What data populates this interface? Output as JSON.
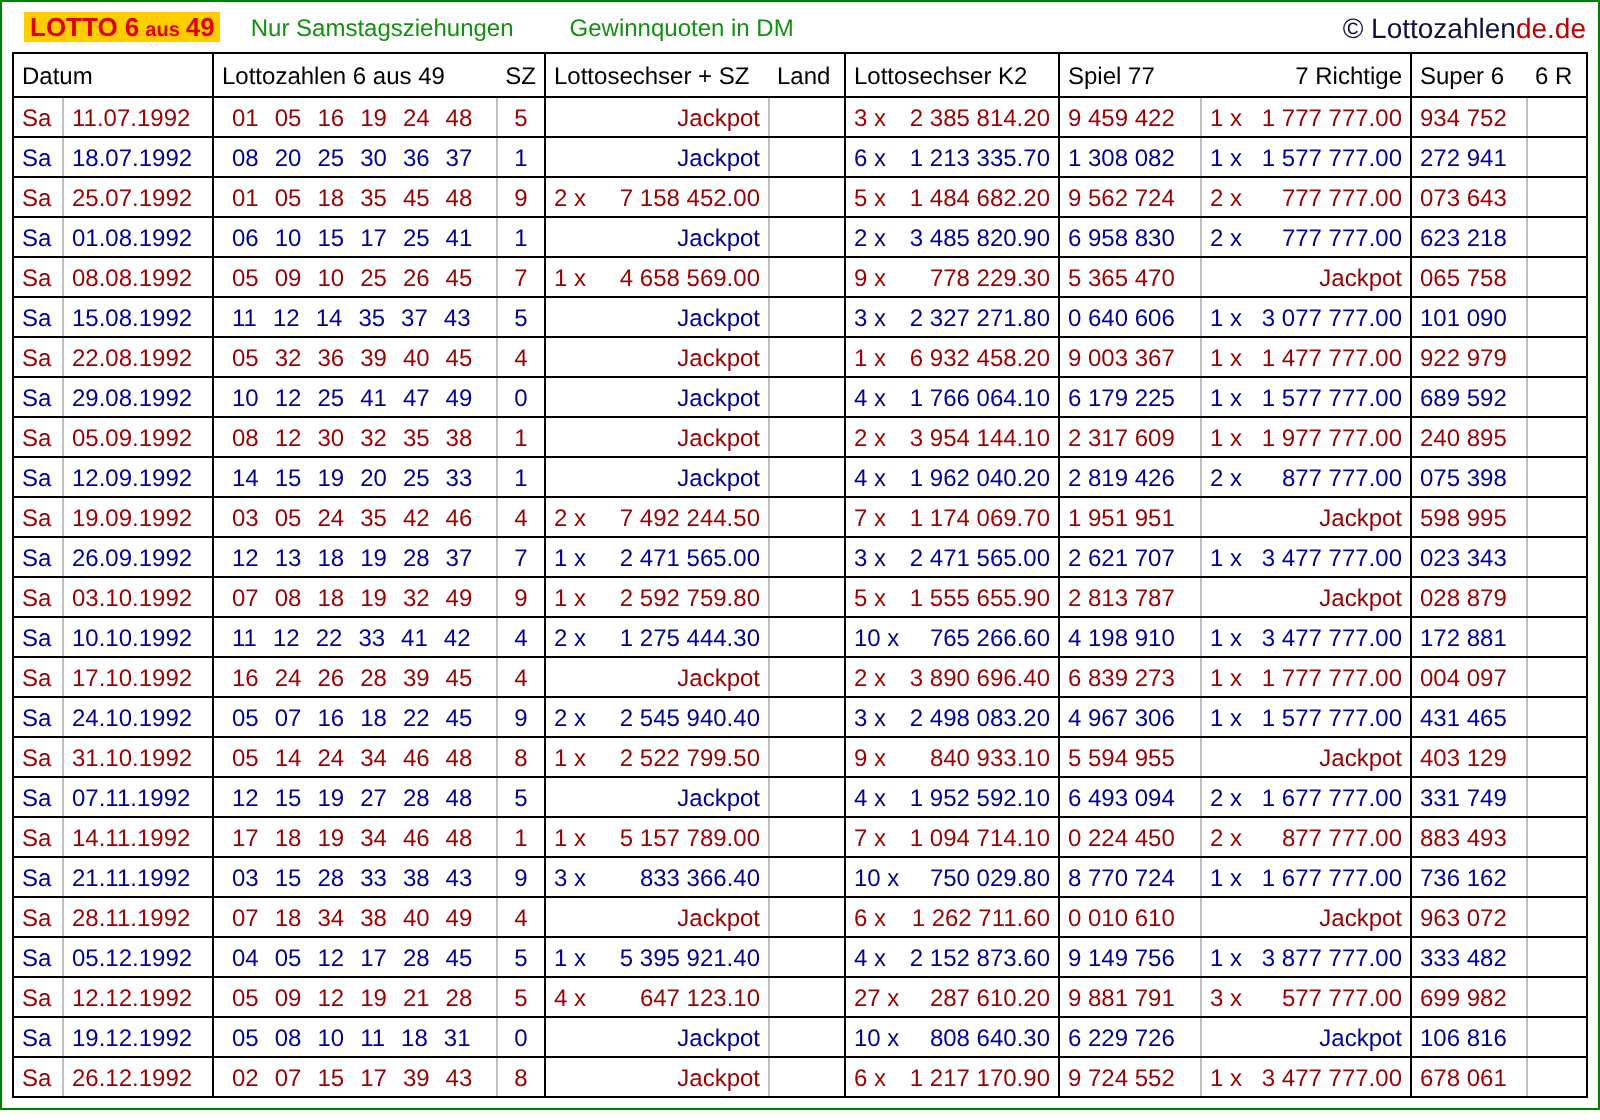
{
  "header": {
    "logo": [
      "LOTTO 6",
      "aus",
      "49"
    ],
    "links": [
      "Nur Samstagsziehungen",
      "Gewinnquoten in DM"
    ],
    "brand": [
      "© Lottozahlen",
      "de.de"
    ]
  },
  "table": {
    "columns": [
      "Datum",
      "Lottozahlen 6 aus 49",
      "SZ",
      "Lottosechser + SZ",
      "Land",
      "Lottosechser K2",
      "Spiel 77",
      "7 Richtige",
      "Super 6",
      "6 R"
    ],
    "rows": [
      {
        "day": "Sa",
        "date": "11.07.1992",
        "numbers": [
          "01",
          "05",
          "16",
          "19",
          "24",
          "48"
        ],
        "sz": "5",
        "sechser": {
          "amount": "Jackpot"
        },
        "k2": {
          "count": "3 x",
          "amount": "2 385 814.20"
        },
        "spiel77": "9 459 422",
        "richtige7": {
          "count": "1 x",
          "amount": "1 777 777.00"
        },
        "super6": "934 752"
      },
      {
        "day": "Sa",
        "date": "18.07.1992",
        "numbers": [
          "08",
          "20",
          "25",
          "30",
          "36",
          "37"
        ],
        "sz": "1",
        "sechser": {
          "amount": "Jackpot"
        },
        "k2": {
          "count": "6 x",
          "amount": "1 213 335.70"
        },
        "spiel77": "1 308 082",
        "richtige7": {
          "count": "1 x",
          "amount": "1 577 777.00"
        },
        "super6": "272 941"
      },
      {
        "day": "Sa",
        "date": "25.07.1992",
        "numbers": [
          "01",
          "05",
          "18",
          "35",
          "45",
          "48"
        ],
        "sz": "9",
        "sechser": {
          "count": "2 x",
          "amount": "7 158 452.00"
        },
        "k2": {
          "count": "5 x",
          "amount": "1 484 682.20"
        },
        "spiel77": "9 562 724",
        "richtige7": {
          "count": "2 x",
          "amount": "777 777.00"
        },
        "super6": "073 643"
      },
      {
        "day": "Sa",
        "date": "01.08.1992",
        "numbers": [
          "06",
          "10",
          "15",
          "17",
          "25",
          "41"
        ],
        "sz": "1",
        "sechser": {
          "amount": "Jackpot"
        },
        "k2": {
          "count": "2 x",
          "amount": "3 485 820.90"
        },
        "spiel77": "6 958 830",
        "richtige7": {
          "count": "2 x",
          "amount": "777 777.00"
        },
        "super6": "623 218"
      },
      {
        "day": "Sa",
        "date": "08.08.1992",
        "numbers": [
          "05",
          "09",
          "10",
          "25",
          "26",
          "45"
        ],
        "sz": "7",
        "sechser": {
          "count": "1 x",
          "amount": "4 658 569.00"
        },
        "k2": {
          "count": "9 x",
          "amount": "778 229.30"
        },
        "spiel77": "5 365 470",
        "richtige7": {
          "amount": "Jackpot"
        },
        "super6": "065 758"
      },
      {
        "day": "Sa",
        "date": "15.08.1992",
        "numbers": [
          "11",
          "12",
          "14",
          "35",
          "37",
          "43"
        ],
        "sz": "5",
        "sechser": {
          "amount": "Jackpot"
        },
        "k2": {
          "count": "3 x",
          "amount": "2 327 271.80"
        },
        "spiel77": "0 640 606",
        "richtige7": {
          "count": "1 x",
          "amount": "3 077 777.00"
        },
        "super6": "101 090"
      },
      {
        "day": "Sa",
        "date": "22.08.1992",
        "numbers": [
          "05",
          "32",
          "36",
          "39",
          "40",
          "45"
        ],
        "sz": "4",
        "sechser": {
          "amount": "Jackpot"
        },
        "k2": {
          "count": "1 x",
          "amount": "6 932 458.20"
        },
        "spiel77": "9 003 367",
        "richtige7": {
          "count": "1 x",
          "amount": "1 477 777.00"
        },
        "super6": "922 979"
      },
      {
        "day": "Sa",
        "date": "29.08.1992",
        "numbers": [
          "10",
          "12",
          "25",
          "41",
          "47",
          "49"
        ],
        "sz": "0",
        "sechser": {
          "amount": "Jackpot"
        },
        "k2": {
          "count": "4 x",
          "amount": "1 766 064.10"
        },
        "spiel77": "6 179 225",
        "richtige7": {
          "count": "1 x",
          "amount": "1 577 777.00"
        },
        "super6": "689 592"
      },
      {
        "day": "Sa",
        "date": "05.09.1992",
        "numbers": [
          "08",
          "12",
          "30",
          "32",
          "35",
          "38"
        ],
        "sz": "1",
        "sechser": {
          "amount": "Jackpot"
        },
        "k2": {
          "count": "2 x",
          "amount": "3 954 144.10"
        },
        "spiel77": "2 317 609",
        "richtige7": {
          "count": "1 x",
          "amount": "1 977 777.00"
        },
        "super6": "240 895"
      },
      {
        "day": "Sa",
        "date": "12.09.1992",
        "numbers": [
          "14",
          "15",
          "19",
          "20",
          "25",
          "33"
        ],
        "sz": "1",
        "sechser": {
          "amount": "Jackpot"
        },
        "k2": {
          "count": "4 x",
          "amount": "1 962 040.20"
        },
        "spiel77": "2 819 426",
        "richtige7": {
          "count": "2 x",
          "amount": "877 777.00"
        },
        "super6": "075 398"
      },
      {
        "day": "Sa",
        "date": "19.09.1992",
        "numbers": [
          "03",
          "05",
          "24",
          "35",
          "42",
          "46"
        ],
        "sz": "4",
        "sechser": {
          "count": "2 x",
          "amount": "7 492 244.50"
        },
        "k2": {
          "count": "7 x",
          "amount": "1 174 069.70"
        },
        "spiel77": "1 951 951",
        "richtige7": {
          "amount": "Jackpot"
        },
        "super6": "598 995"
      },
      {
        "day": "Sa",
        "date": "26.09.1992",
        "numbers": [
          "12",
          "13",
          "18",
          "19",
          "28",
          "37"
        ],
        "sz": "7",
        "sechser": {
          "count": "1 x",
          "amount": "2 471 565.00"
        },
        "k2": {
          "count": "3 x",
          "amount": "2 471 565.00"
        },
        "spiel77": "2 621 707",
        "richtige7": {
          "count": "1 x",
          "amount": "3 477 777.00"
        },
        "super6": "023 343"
      },
      {
        "day": "Sa",
        "date": "03.10.1992",
        "numbers": [
          "07",
          "08",
          "18",
          "19",
          "32",
          "49"
        ],
        "sz": "9",
        "sechser": {
          "count": "1 x",
          "amount": "2 592 759.80"
        },
        "k2": {
          "count": "5 x",
          "amount": "1 555 655.90"
        },
        "spiel77": "2 813 787",
        "richtige7": {
          "amount": "Jackpot"
        },
        "super6": "028 879"
      },
      {
        "day": "Sa",
        "date": "10.10.1992",
        "numbers": [
          "11",
          "12",
          "22",
          "33",
          "41",
          "42"
        ],
        "sz": "4",
        "sechser": {
          "count": "2 x",
          "amount": "1 275 444.30"
        },
        "k2": {
          "count": "10 x",
          "amount": "765 266.60"
        },
        "spiel77": "4 198 910",
        "richtige7": {
          "count": "1 x",
          "amount": "3 477 777.00"
        },
        "super6": "172 881"
      },
      {
        "day": "Sa",
        "date": "17.10.1992",
        "numbers": [
          "16",
          "24",
          "26",
          "28",
          "39",
          "45"
        ],
        "sz": "4",
        "sechser": {
          "amount": "Jackpot"
        },
        "k2": {
          "count": "2 x",
          "amount": "3 890 696.40"
        },
        "spiel77": "6 839 273",
        "richtige7": {
          "count": "1 x",
          "amount": "1 777 777.00"
        },
        "super6": "004 097"
      },
      {
        "day": "Sa",
        "date": "24.10.1992",
        "numbers": [
          "05",
          "07",
          "16",
          "18",
          "22",
          "45"
        ],
        "sz": "9",
        "sechser": {
          "count": "2 x",
          "amount": "2 545 940.40"
        },
        "k2": {
          "count": "3 x",
          "amount": "2 498 083.20"
        },
        "spiel77": "4 967 306",
        "richtige7": {
          "count": "1 x",
          "amount": "1 577 777.00"
        },
        "super6": "431 465"
      },
      {
        "day": "Sa",
        "date": "31.10.1992",
        "numbers": [
          "05",
          "14",
          "24",
          "34",
          "46",
          "48"
        ],
        "sz": "8",
        "sechser": {
          "count": "1 x",
          "amount": "2 522 799.50"
        },
        "k2": {
          "count": "9 x",
          "amount": "840 933.10"
        },
        "spiel77": "5 594 955",
        "richtige7": {
          "amount": "Jackpot"
        },
        "super6": "403 129"
      },
      {
        "day": "Sa",
        "date": "07.11.1992",
        "numbers": [
          "12",
          "15",
          "19",
          "27",
          "28",
          "48"
        ],
        "sz": "5",
        "sechser": {
          "amount": "Jackpot"
        },
        "k2": {
          "count": "4 x",
          "amount": "1 952 592.10"
        },
        "spiel77": "6 493 094",
        "richtige7": {
          "count": "2 x",
          "amount": "1 677 777.00"
        },
        "super6": "331 749"
      },
      {
        "day": "Sa",
        "date": "14.11.1992",
        "numbers": [
          "17",
          "18",
          "19",
          "34",
          "46",
          "48"
        ],
        "sz": "1",
        "sechser": {
          "count": "1 x",
          "amount": "5 157 789.00"
        },
        "k2": {
          "count": "7 x",
          "amount": "1 094 714.10"
        },
        "spiel77": "0 224 450",
        "richtige7": {
          "count": "2 x",
          "amount": "877 777.00"
        },
        "super6": "883 493"
      },
      {
        "day": "Sa",
        "date": "21.11.1992",
        "numbers": [
          "03",
          "15",
          "28",
          "33",
          "38",
          "43"
        ],
        "sz": "9",
        "sechser": {
          "count": "3 x",
          "amount": "833 366.40"
        },
        "k2": {
          "count": "10 x",
          "amount": "750 029.80"
        },
        "spiel77": "8 770 724",
        "richtige7": {
          "count": "1 x",
          "amount": "1 677 777.00"
        },
        "super6": "736 162"
      },
      {
        "day": "Sa",
        "date": "28.11.1992",
        "numbers": [
          "07",
          "18",
          "34",
          "38",
          "40",
          "49"
        ],
        "sz": "4",
        "sechser": {
          "amount": "Jackpot"
        },
        "k2": {
          "count": "6 x",
          "amount": "1 262 711.60"
        },
        "spiel77": "0 010 610",
        "richtige7": {
          "amount": "Jackpot"
        },
        "super6": "963 072"
      },
      {
        "day": "Sa",
        "date": "05.12.1992",
        "numbers": [
          "04",
          "05",
          "12",
          "17",
          "28",
          "45"
        ],
        "sz": "5",
        "sechser": {
          "count": "1 x",
          "amount": "5 395 921.40"
        },
        "k2": {
          "count": "4 x",
          "amount": "2 152 873.60"
        },
        "spiel77": "9 149 756",
        "richtige7": {
          "count": "1 x",
          "amount": "3 877 777.00"
        },
        "super6": "333 482"
      },
      {
        "day": "Sa",
        "date": "12.12.1992",
        "numbers": [
          "05",
          "09",
          "12",
          "19",
          "21",
          "28"
        ],
        "sz": "5",
        "sechser": {
          "count": "4 x",
          "amount": "647 123.10"
        },
        "k2": {
          "count": "27 x",
          "amount": "287 610.20"
        },
        "spiel77": "9 881 791",
        "richtige7": {
          "count": "3 x",
          "amount": "577 777.00"
        },
        "super6": "699 982"
      },
      {
        "day": "Sa",
        "date": "19.12.1992",
        "numbers": [
          "05",
          "08",
          "10",
          "11",
          "18",
          "31"
        ],
        "sz": "0",
        "sechser": {
          "amount": "Jackpot"
        },
        "k2": {
          "count": "10 x",
          "amount": "808 640.30"
        },
        "spiel77": "6 229 726",
        "richtige7": {
          "amount": "Jackpot"
        },
        "super6": "106 816"
      },
      {
        "day": "Sa",
        "date": "26.12.1992",
        "numbers": [
          "02",
          "07",
          "15",
          "17",
          "39",
          "43"
        ],
        "sz": "8",
        "sechser": {
          "amount": "Jackpot"
        },
        "k2": {
          "count": "6 x",
          "amount": "1 217 170.90"
        },
        "spiel77": "9 724 552",
        "richtige7": {
          "count": "1 x",
          "amount": "3 477 777.00"
        },
        "super6": "678 061"
      }
    ]
  }
}
